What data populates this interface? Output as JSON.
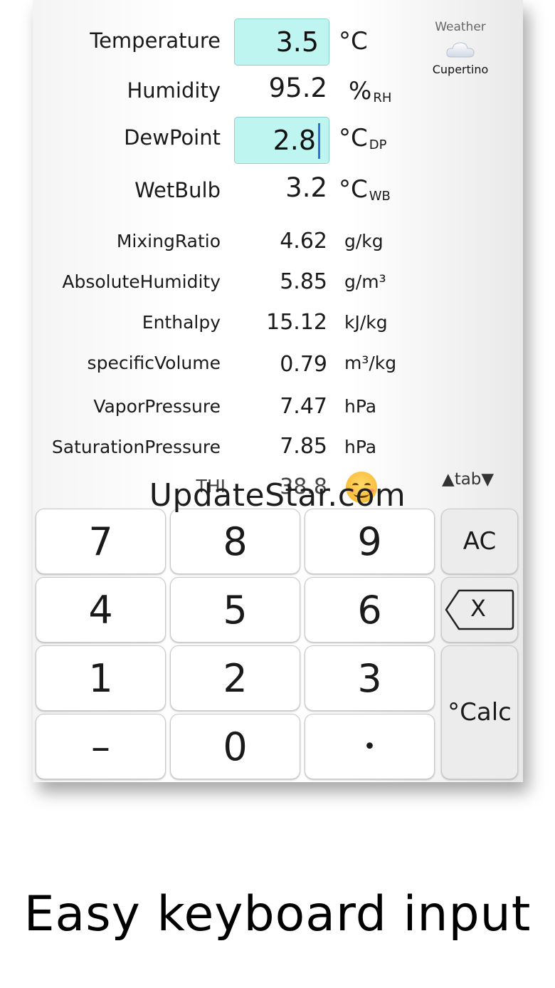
{
  "fields": {
    "temperature": {
      "label": "Temperature",
      "value": "3.5",
      "unit": "°C"
    },
    "humidity": {
      "label": "Humidity",
      "value": "95.2",
      "unit": "%",
      "unit_sub": "RH"
    },
    "dewpoint": {
      "label": "DewPoint",
      "value": "2.8",
      "unit": "°C",
      "unit_sub": "DP"
    },
    "wetbulb": {
      "label": "WetBulb",
      "value": "3.2",
      "unit": "°C",
      "unit_sub": "WB"
    },
    "mixing_ratio": {
      "label": "MixingRatio",
      "value": "4.62",
      "unit": "g/kg"
    },
    "absolute_humidity": {
      "label": "AbsoluteHumidity",
      "value": "5.85",
      "unit": "g/m³"
    },
    "enthalpy": {
      "label": "Enthalpy",
      "value": "15.12",
      "unit": "kJ/kg"
    },
    "specific_volume": {
      "label": "specificVolume",
      "value": "0.79",
      "unit": "m³/kg"
    },
    "vapor_pressure": {
      "label": "VaporPressure",
      "value": "7.47",
      "unit": "hPa"
    },
    "saturation_pressure": {
      "label": "SaturationPressure",
      "value": "7.85",
      "unit": "hPa"
    },
    "thi": {
      "label": "THI",
      "value": "38.8",
      "icon": "smiling-face-icon"
    }
  },
  "weather": {
    "title": "Weather",
    "city": "Cupertino",
    "icon": "cloud-icon"
  },
  "tab_control": "▲tab▼",
  "watermark": "UpdateStar.com",
  "keypad": {
    "k7": "7",
    "k8": "8",
    "k9": "9",
    "ac": "AC",
    "k4": "4",
    "k5": "5",
    "k6": "6",
    "backspace": "X",
    "k1": "1",
    "k2": "2",
    "k3": "3",
    "calc": "°Calc",
    "minus": "–",
    "k0": "0",
    "dot": "•"
  },
  "caption": "Easy keyboard input",
  "colors": {
    "input_bg": "#bff5f1",
    "caret": "#2f6fe0"
  }
}
